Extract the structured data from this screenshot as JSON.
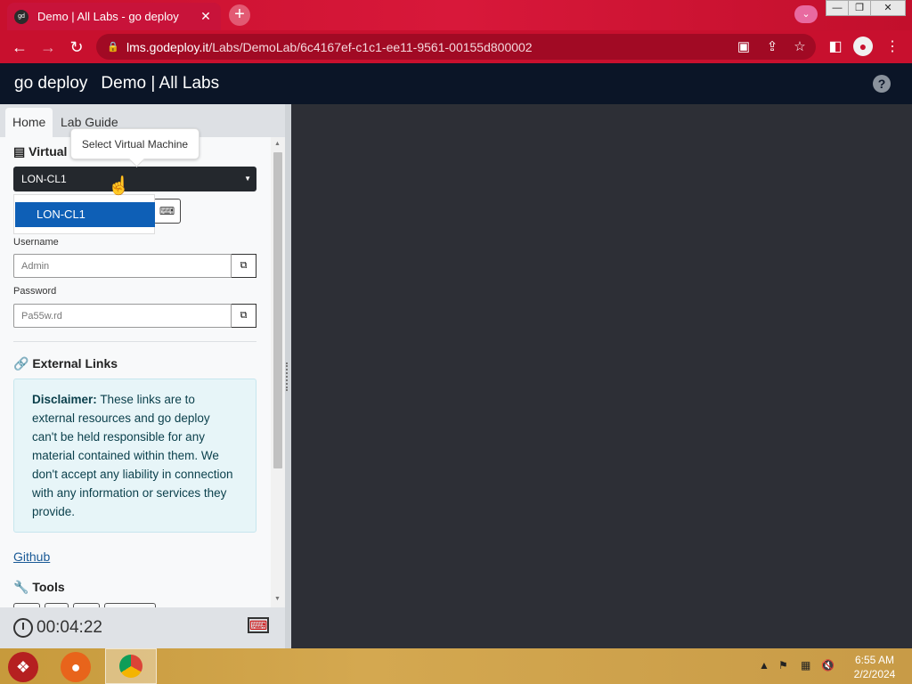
{
  "browser": {
    "tab_title": "Demo | All Labs - go deploy",
    "favicon_text": "gd",
    "close_glyph": "✕",
    "new_tab_glyph": "+",
    "url_host": "lms.godeploy.it",
    "url_path": "/Labs/DemoLab/6c4167ef-c1c1-ee11-9561-00155d800002"
  },
  "app": {
    "brand": "go deploy",
    "title": "Demo | All Labs",
    "help_glyph": "?"
  },
  "panel": {
    "tabs": [
      {
        "label": "Home"
      },
      {
        "label": "Lab Guide"
      }
    ],
    "vm_section_title": "Virtual",
    "tooltip": "Select Virtual Machine",
    "vm_selected": "LON-CL1",
    "vm_options": [
      "LON-CL1"
    ],
    "username_label": "Username",
    "username_value": "Admin",
    "password_label": "Password",
    "password_value": "Pa55w.rd",
    "external_links_title": "External Links",
    "disclaimer_bold": "Disclaimer:",
    "disclaimer_text": "These links are to external resources and go deploy can't be held responsible for any material contained within them. We don't accept any liability in connection with any information or services they provide.",
    "github_link": "Github",
    "tools_title": "Tools",
    "timer": "00:04:22"
  },
  "taskbar": {
    "time": "6:55 AM",
    "date": "2/2/2024"
  },
  "colors": {
    "browser_accent": "#c8102e",
    "app_header": "#0b1527",
    "selected_option": "#0e5fb6",
    "vm_background": "#2d2f36"
  },
  "icons": [
    "favicon-icon",
    "close-tab-icon",
    "new-tab-icon",
    "back-icon",
    "forward-icon",
    "reload-icon",
    "lock-icon",
    "share-icon",
    "star-icon",
    "sidebar-icon",
    "profile-icon",
    "more-icon",
    "help-icon",
    "server-icon",
    "keyboard-icon",
    "copy-icon",
    "link-icon",
    "wrench-icon",
    "alarm-clock-icon",
    "keyboard-off-icon",
    "cursor-hand-icon"
  ]
}
